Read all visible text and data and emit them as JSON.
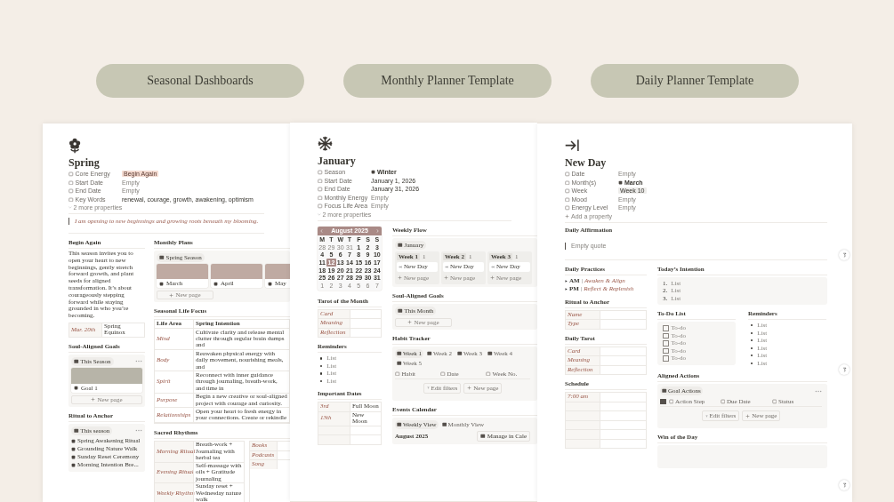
{
  "pills": [
    "Seasonal Dashboards",
    "Monthly Planner Template",
    "Daily Planner Template"
  ],
  "panels": [
    {
      "kind": "seasonal",
      "title": "Spring",
      "properties": [
        {
          "label": "Core Energy",
          "value": "Begin Again",
          "kind": "tag"
        },
        {
          "label": "Start Date",
          "value": "Empty",
          "kind": "empty"
        },
        {
          "label": "End Date",
          "value": "Empty",
          "kind": "empty"
        },
        {
          "label": "Key Words",
          "value": "renewal, courage, growth, awakening, optimism",
          "kind": "plain"
        }
      ],
      "footer": {
        "kind": "expand",
        "text": "2 more properties"
      },
      "wide": [
        {
          "kind": "quote",
          "text": "I am opening to new beginnings and growing roots beneath my blooming."
        }
      ],
      "columns": [
        [
          {
            "kind": "text",
            "title": "Begin Again",
            "text": "This season invites you to open your heart to new beginnings, gently stretch forward growth, and plant seeds for aligned transformation. It’s about courageously stepping forward while staying grounded in who you’re becoming."
          },
          {
            "kind": "kv",
            "rows": [
              {
                "key": "Mar. 20th",
                "value": "Spring Equinox"
              }
            ]
          },
          {
            "kind": "gallery",
            "title": "Soul-Aligned Goals",
            "view": "This Season",
            "menu": true,
            "cards": [
              {
                "title": "Goal 1",
                "color": "#b7b4a8"
              }
            ],
            "new_page": "New page"
          },
          {
            "kind": "db_list",
            "title": "Ritual to Anchor",
            "view": "This season",
            "items": [
              "Spring Awakening Ritual",
              "Grounding Nature Walk",
              "Sunday Reset Ceremony",
              "Morning Intention Bre..."
            ]
          }
        ],
        [
          {
            "kind": "gallery",
            "title": "Monthly Plans",
            "view": "Spring Season",
            "cards": [
              {
                "title": "March",
                "color": "#bfaaa2"
              },
              {
                "title": "April",
                "color": "#bfaaa2"
              },
              {
                "title": "May",
                "color": "#bfaaa2"
              }
            ],
            "new_page": "New page"
          },
          {
            "kind": "table",
            "title": "Seasonal Life Focus",
            "columns": [
              "Life Area",
              "Spring Intention"
            ],
            "rows": [
              [
                "Mind",
                "Cultivate clarity and release mental clutter through regular brain dumps and"
              ],
              [
                "Body",
                "Reawaken physical energy with daily movement, nourishing meals, and"
              ],
              [
                "Spirit",
                "Reconnect with inner guidance through journaling, breath-work, and time in"
              ],
              [
                "Purpose",
                "Begin a new creative or soul-aligned project with courage and curiosity."
              ],
              [
                "Relationships",
                "Open your heart to fresh energy in your connections. Create or rekindle"
              ]
            ]
          },
          {
            "kind": "kv_pair",
            "title": "Sacred Rhythms",
            "tables": [
              [
                {
                  "key": "Morning Ritual",
                  "value": "Breath-work + Journaling with herbal tea"
                },
                {
                  "key": "Evening Ritual",
                  "value": "Self-massage with oils + Gratitude journaling"
                },
                {
                  "key": "Weekly Rhythm",
                  "value": "Sunday reset + Wednesday nature walk"
                }
              ],
              [
                {
                  "key": "Books"
                },
                {
                  "key": "Podcasts"
                },
                {
                  "key": "Song"
                }
              ]
            ]
          }
        ]
      ]
    },
    {
      "kind": "monthly",
      "title": "January",
      "properties": [
        {
          "label": "Season",
          "value": "Winter",
          "kind": "icon"
        },
        {
          "label": "Start Date",
          "value": "January 1, 2026",
          "kind": "plain"
        },
        {
          "label": "End Date",
          "value": "January 31, 2026",
          "kind": "plain"
        },
        {
          "label": "Monthly Energy",
          "value": "Empty",
          "kind": "empty"
        },
        {
          "label": "Focus Life Area",
          "value": "Empty",
          "kind": "empty"
        }
      ],
      "footer": {
        "kind": "expand",
        "text": "2 more properties"
      },
      "columns": [
        [
          {
            "kind": "calendar",
            "month": "August 2025",
            "weekdays": [
              "M",
              "T",
              "W",
              "T",
              "F",
              "S",
              "S"
            ],
            "weeks": [
              [
                {
                  "d": "28",
                  "muted": true,
                  "selected": false
                },
                {
                  "d": "29",
                  "muted": true,
                  "selected": false
                },
                {
                  "d": "30",
                  "muted": true,
                  "selected": false
                },
                {
                  "d": "31",
                  "muted": true,
                  "selected": false
                },
                {
                  "d": "1",
                  "muted": false,
                  "selected": false
                },
                {
                  "d": "2",
                  "muted": false,
                  "selected": false
                },
                {
                  "d": "3",
                  "muted": false,
                  "selected": false
                }
              ],
              [
                {
                  "d": "4",
                  "muted": false,
                  "selected": false
                },
                {
                  "d": "5",
                  "muted": false,
                  "selected": false
                },
                {
                  "d": "6",
                  "muted": false,
                  "selected": false
                },
                {
                  "d": "7",
                  "muted": false,
                  "selected": false
                },
                {
                  "d": "8",
                  "muted": false,
                  "selected": false
                },
                {
                  "d": "9",
                  "muted": false,
                  "selected": false
                },
                {
                  "d": "10",
                  "muted": false,
                  "selected": false
                }
              ],
              [
                {
                  "d": "11",
                  "muted": false,
                  "selected": false
                },
                {
                  "d": "12",
                  "muted": false,
                  "selected": true
                },
                {
                  "d": "13",
                  "muted": false,
                  "selected": false
                },
                {
                  "d": "14",
                  "muted": false,
                  "selected": false
                },
                {
                  "d": "15",
                  "muted": false,
                  "selected": false
                },
                {
                  "d": "16",
                  "muted": false,
                  "selected": false
                },
                {
                  "d": "17",
                  "muted": false,
                  "selected": false
                }
              ],
              [
                {
                  "d": "18",
                  "muted": false,
                  "selected": false
                },
                {
                  "d": "19",
                  "muted": false,
                  "selected": false
                },
                {
                  "d": "20",
                  "muted": false,
                  "selected": false
                },
                {
                  "d": "21",
                  "muted": false,
                  "selected": false
                },
                {
                  "d": "22",
                  "muted": false,
                  "selected": false
                },
                {
                  "d": "23",
                  "muted": false,
                  "selected": false
                },
                {
                  "d": "24",
                  "muted": false,
                  "selected": false
                }
              ],
              [
                {
                  "d": "25",
                  "muted": false,
                  "selected": false
                },
                {
                  "d": "26",
                  "muted": false,
                  "selected": false
                },
                {
                  "d": "27",
                  "muted": false,
                  "selected": false
                },
                {
                  "d": "28",
                  "muted": false,
                  "selected": false
                },
                {
                  "d": "29",
                  "muted": false,
                  "selected": false
                },
                {
                  "d": "30",
                  "muted": false,
                  "selected": false
                },
                {
                  "d": "31",
                  "muted": false,
                  "selected": false
                }
              ],
              [
                {
                  "d": "1",
                  "muted": true,
                  "selected": false
                },
                {
                  "d": "2",
                  "muted": true,
                  "selected": false
                },
                {
                  "d": "3",
                  "muted": true,
                  "selected": false
                },
                {
                  "d": "4",
                  "muted": true,
                  "selected": false
                },
                {
                  "d": "5",
                  "muted": true,
                  "selected": false
                },
                {
                  "d": "6",
                  "muted": true,
                  "selected": false
                },
                {
                  "d": "7",
                  "muted": true,
                  "selected": false
                }
              ]
            ]
          },
          {
            "kind": "kv",
            "title": "Tarot of the Month",
            "rows": [
              {
                "key": "Card"
              },
              {
                "key": "Meaning"
              },
              {
                "key": "Reflection"
              }
            ]
          },
          {
            "kind": "bullets",
            "title": "Reminders",
            "placeholder": true,
            "items": [
              "List",
              "List",
              "List",
              "List"
            ]
          },
          {
            "kind": "kv",
            "title": "Important Dates",
            "rows": [
              {
                "key": "3rd",
                "value": "Full Moon"
              },
              {
                "key": "13th",
                "value": "New Moon"
              },
              {},
              {}
            ]
          }
        ],
        [
          {
            "kind": "board",
            "title": "Weekly Flow",
            "view": "January",
            "columns": [
              {
                "title": "Week 1",
                "count": "1",
                "cards": [
                  "New Day"
                ],
                "new_page": "New page"
              },
              {
                "title": "Week 2",
                "count": "1",
                "cards": [
                  "New Day"
                ],
                "new_page": "New page"
              },
              {
                "title": "Week 3",
                "count": "1",
                "cards": [
                  "New Day"
                ],
                "new_page": "New page"
              }
            ]
          },
          {
            "kind": "gallery",
            "title": "Soul-Aligned Goals",
            "view": "This Month",
            "new_page": "New page"
          },
          {
            "kind": "tabbed_table",
            "title": "Habit Tracker",
            "tabs": [
              {
                "label": "Week 1",
                "selected": true
              },
              {
                "label": "Week 2",
                "selected": false
              },
              {
                "label": "Week 3",
                "selected": false
              },
              {
                "label": "Week 4",
                "selected": false
              },
              {
                "label": "Week 5",
                "selected": false
              }
            ],
            "columns": [
              "Habit",
              "Date",
              "Week No."
            ],
            "buttons": [
              "Edit filters",
              "New page"
            ]
          },
          {
            "kind": "events",
            "title": "Events Calendar",
            "tabs": [
              {
                "label": "Weekly View",
                "selected": true
              },
              {
                "label": "Monthly View",
                "selected": false
              }
            ],
            "month": "August 2025",
            "action": "Manage in Cale"
          }
        ]
      ]
    },
    {
      "kind": "daily",
      "title": "New Day",
      "properties": [
        {
          "label": "Date",
          "value": "Empty",
          "kind": "empty"
        },
        {
          "label": "Month(s)",
          "value": "March",
          "kind": "icon"
        },
        {
          "label": "Week",
          "value": "Week 10",
          "kind": "tag"
        },
        {
          "label": "Mood",
          "value": "Empty",
          "kind": "empty"
        },
        {
          "label": "Energy Level",
          "value": "Empty",
          "kind": "empty"
        }
      ],
      "footer": {
        "kind": "add",
        "text": "Add a property"
      },
      "wide": [
        {
          "kind": "quote",
          "title": "Daily Affirmation",
          "placeholder": "Empty quote"
        }
      ],
      "columns": [
        [
          {
            "kind": "toggles",
            "title": "Daily Practices",
            "items": [
              {
                "label": "AM",
                "separator": "|",
                "detail": "Awaken & Align"
              },
              {
                "label": "PM",
                "separator": "|",
                "detail": "Reflect & Replenish"
              }
            ]
          },
          {
            "kind": "kv",
            "title": "Ritual to Anchor",
            "rows": [
              {
                "key": "Name"
              },
              {
                "key": "Type"
              }
            ]
          },
          {
            "kind": "kv",
            "title": "Daily Tarot",
            "rows": [
              {
                "key": "Card"
              },
              {
                "key": "Meaning"
              },
              {
                "key": "Reflection"
              }
            ]
          },
          {
            "kind": "kv",
            "title": "Schedule",
            "rows": [
              {
                "key": "7:00 am"
              },
              {},
              {},
              {},
              {},
              {}
            ]
          }
        ],
        [
          {
            "kind": "numbered",
            "title": "Today’s Intention",
            "placeholder": true,
            "items": [
              {
                "marker": "1.",
                "text": "List"
              },
              {
                "marker": "2.",
                "text": "List"
              },
              {
                "marker": "3.",
                "text": "List"
              }
            ]
          },
          {
            "kind": "split",
            "parts": [
              {
                "kind": "todo",
                "title": "To-Do List",
                "items": [
                  {
                    "text": "To-do",
                    "checked": false
                  },
                  {
                    "text": "To-do",
                    "checked": false
                  },
                  {
                    "text": "To-do",
                    "checked": false
                  },
                  {
                    "text": "To-do",
                    "checked": false
                  },
                  {
                    "text": "To-do",
                    "checked": false
                  }
                ]
              },
              {
                "kind": "bullets",
                "title": "Reminders",
                "placeholder": true,
                "items": [
                  "List",
                  "List",
                  "List",
                  "List",
                  "List",
                  "List"
                ]
              }
            ]
          },
          {
            "kind": "tabbed_table",
            "title": "Aligned Actions",
            "tabs": [
              {
                "label": "Goal Actions",
                "selected": true
              }
            ],
            "checkbox_column": true,
            "columns": [
              "Action Step",
              "Due Date",
              "Status"
            ],
            "buttons": [
              "Edit filters",
              "New page"
            ]
          },
          {
            "kind": "heading",
            "title": "Win of the Day"
          }
        ]
      ]
    }
  ]
}
